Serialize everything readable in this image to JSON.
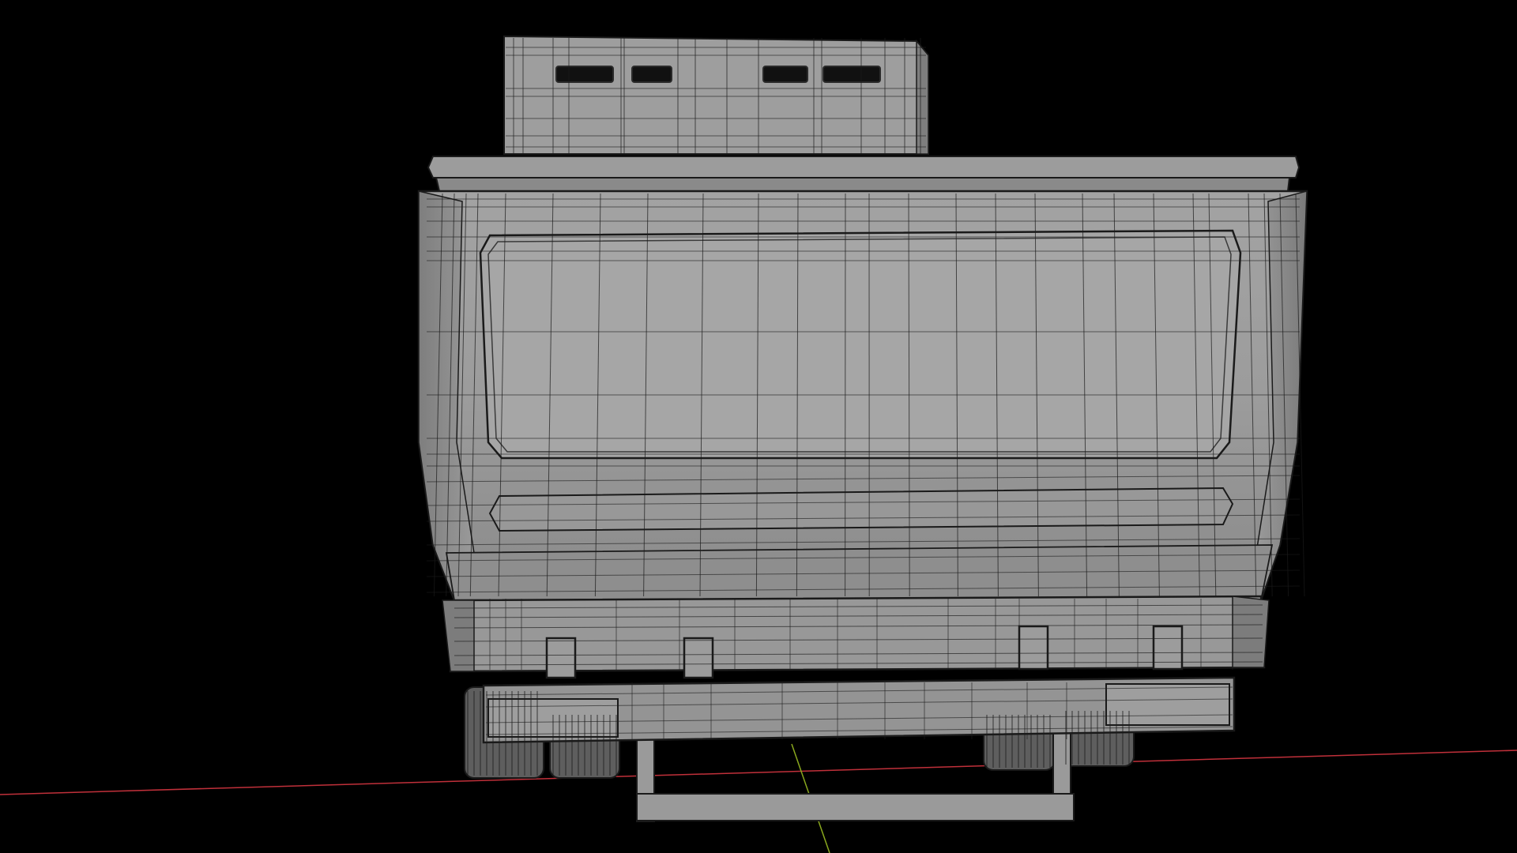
{
  "viewport": {
    "background_color": "#000000",
    "mesh_fill_color": "#9a9a9a",
    "mesh_shade_color": "#7c7c7c",
    "wire_color": "#1a1a1a",
    "x_axis_color": "#c0303a",
    "y_axis_color": "#8aa81e"
  }
}
